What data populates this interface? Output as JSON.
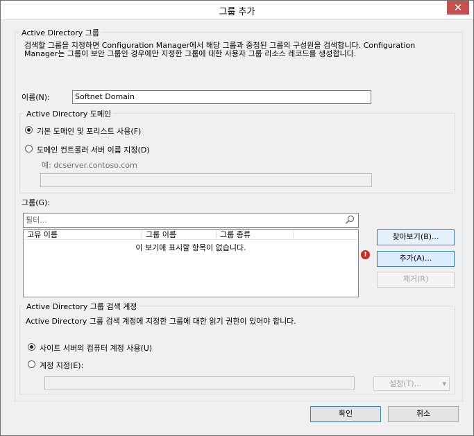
{
  "window": {
    "title": "그룹 추가",
    "close_glyph": "✕"
  },
  "ad_group": {
    "legend": "Active Directory 그룹",
    "description": "검색할 그룹을 지정하면 Configuration Manager에서 해당 그룹과 중첩된 그룹의 구성원을 검색합니다. Configuration Manager는 그룹이 보안 그룹인 경우에만 지정한 그룹에 대한 사용자 그룹 리소스 레코드를 생성합니다.",
    "name_label": "이름(N):",
    "name_value": "Softnet Domain"
  },
  "domain": {
    "legend": "Active Directory 도메인",
    "radio_default": "기본 도메인 및 포리스트 사용(F)",
    "radio_specify": "도메인 컨트롤러 서버 이름 지정(D)",
    "example": "예: dcserver.contoso.com",
    "server_value": ""
  },
  "groups": {
    "label": "그룹(G):",
    "filter_placeholder": "필터...",
    "columns": [
      "고유 이름",
      "그룹 이름",
      "그룹 종류"
    ],
    "empty_message": "이 보기에 표시할 항목이 없습니다.",
    "browse_label": "찾아보기(B)...",
    "add_label": "추가(A)...",
    "remove_label": "제거(R)",
    "warning_glyph": "!"
  },
  "account": {
    "legend": "Active Directory 그룹 검색 계정",
    "description": "Active Directory 그룹 검색 계정에 지정한 그룹에 대한 읽기 권한이 있어야 합니다.",
    "radio_site": "사이트 서버의 컴퓨터 계정 사용(U)",
    "radio_specify": "계정 지정(E):",
    "account_value": "",
    "settings_label": "설정(T)...",
    "settings_arrow": "▾"
  },
  "footer": {
    "ok_label": "확인",
    "cancel_label": "취소"
  }
}
